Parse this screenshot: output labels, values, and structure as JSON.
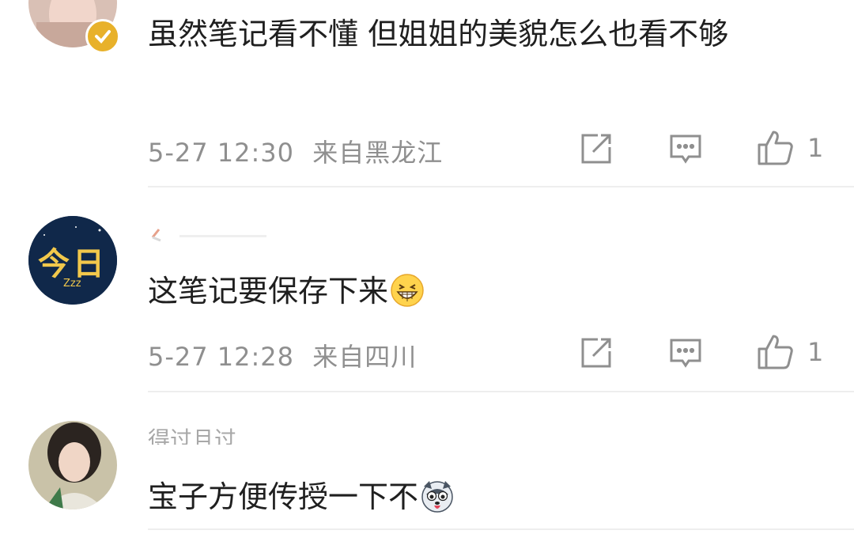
{
  "comments": [
    {
      "author": "",
      "text": "虽然笔记看不懂 但姐姐的美貌怎么也看不够",
      "time": "5-27 12:30",
      "location": "来自黑龙江",
      "likes": "1"
    },
    {
      "author": "",
      "avatar_text": "今日",
      "avatar_subtext": "Zzz",
      "text": "这笔记要保存下来",
      "emoji": "grin-emoji",
      "time": "5-27 12:28",
      "location": "来自四川",
      "likes": "1"
    },
    {
      "author": "得过且过_",
      "text": "宝子方便传授一下不",
      "emoji": "husky-emoji"
    }
  ],
  "icons": {
    "share": "share-icon",
    "reply": "comment-icon",
    "like": "thumbs-up-icon"
  },
  "colors": {
    "text": "#1f1f1f",
    "meta": "#8f8f8f",
    "verified_badge": "#e8b12a"
  }
}
